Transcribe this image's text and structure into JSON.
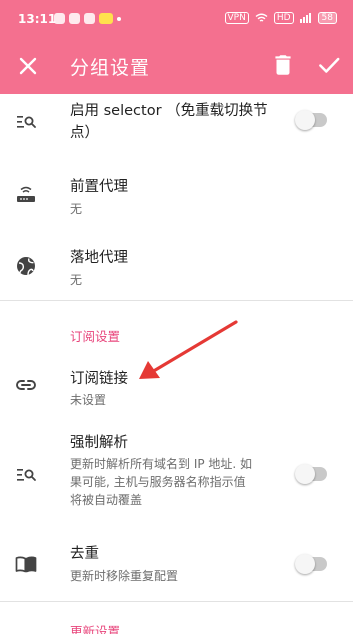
{
  "status_bar": {
    "time": "13:11",
    "network": "VPN",
    "signal": "HD",
    "battery": "58"
  },
  "app_bar": {
    "title": "分组设置"
  },
  "items": [
    {
      "title": "启用 selector （免重载切换节点）",
      "title_l1": "启用 selector （免重载切换节",
      "title_l2": "点）",
      "icon": "manage-search-icon",
      "toggle": false
    },
    {
      "title": "前置代理",
      "subtitle": "无",
      "icon": "router-icon"
    },
    {
      "title": "落地代理",
      "subtitle": "无",
      "icon": "globe-icon"
    }
  ],
  "subscription_section": {
    "label": "订阅设置"
  },
  "sub_items": [
    {
      "title": "订阅链接",
      "subtitle": "未设置",
      "icon": "link-icon"
    },
    {
      "title": "强制解析",
      "subtitle_l1": "更新时解析所有域名到 IP 地址. 如",
      "subtitle_l2": "果可能, 主机与服务器名称指示值",
      "subtitle_l3": "将被自动覆盖",
      "icon": "manage-search-icon",
      "toggle": false
    },
    {
      "title": "去重",
      "subtitle": "更新时移除重复配置",
      "icon": "book-icon",
      "toggle": false
    }
  ],
  "update_section": {
    "label": "更新设置"
  },
  "colors": {
    "accent": "#f4708f",
    "section": "#e8467c",
    "annotation_arrow": "#e53935"
  }
}
